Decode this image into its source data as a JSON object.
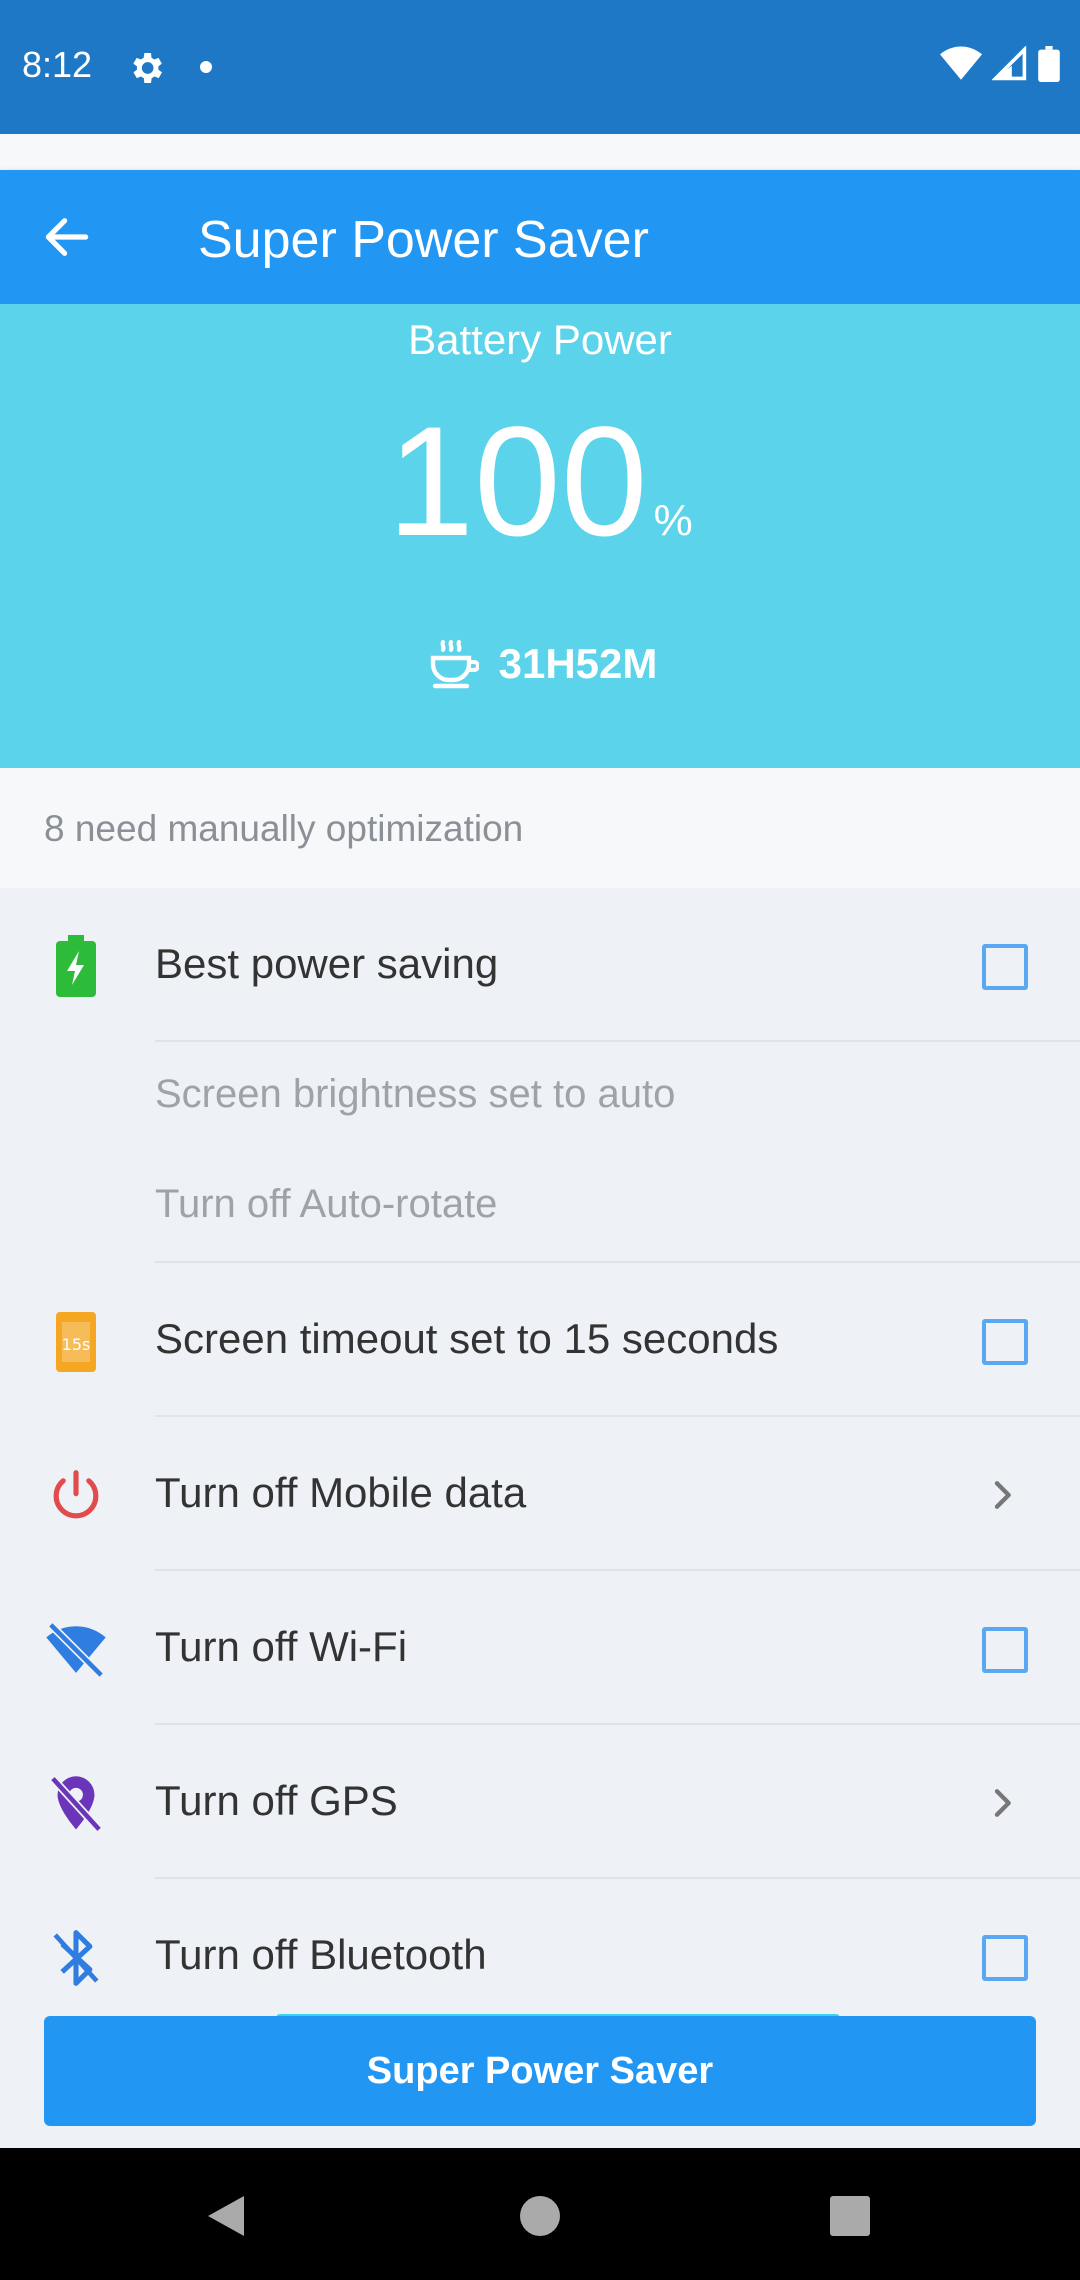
{
  "status_bar": {
    "time": "8:12"
  },
  "app_bar": {
    "title": "Super Power Saver"
  },
  "battery": {
    "label": "Battery Power",
    "value": "100",
    "unit": "%",
    "remaining_time": "31H52M"
  },
  "section": {
    "header": "8 need manually optimization"
  },
  "items": [
    {
      "label": "Best power saving",
      "icon": "battery-charging-icon",
      "control": "checkbox",
      "checked": false
    },
    {
      "label": "Screen timeout set to 15 seconds",
      "icon": "timer-15s-icon",
      "control": "checkbox",
      "checked": false
    },
    {
      "label": "Turn off Mobile data",
      "icon": "power-icon",
      "control": "chevron"
    },
    {
      "label": "Turn off Wi-Fi",
      "icon": "wifi-off-icon",
      "control": "checkbox",
      "checked": false
    },
    {
      "label": "Turn off GPS",
      "icon": "gps-off-icon",
      "control": "chevron"
    },
    {
      "label": "Turn off Bluetooth",
      "icon": "bluetooth-off-icon",
      "control": "checkbox",
      "checked": false
    }
  ],
  "sub_items": [
    "Screen brightness set to auto",
    "Turn off Auto-rotate"
  ],
  "cta": {
    "label": "Super Power Saver"
  },
  "colors": {
    "status_bar": "#1e78c6",
    "app_bar": "#2196f3",
    "hero": "#5bd3ea",
    "checkbox": "#5aa9f0"
  }
}
